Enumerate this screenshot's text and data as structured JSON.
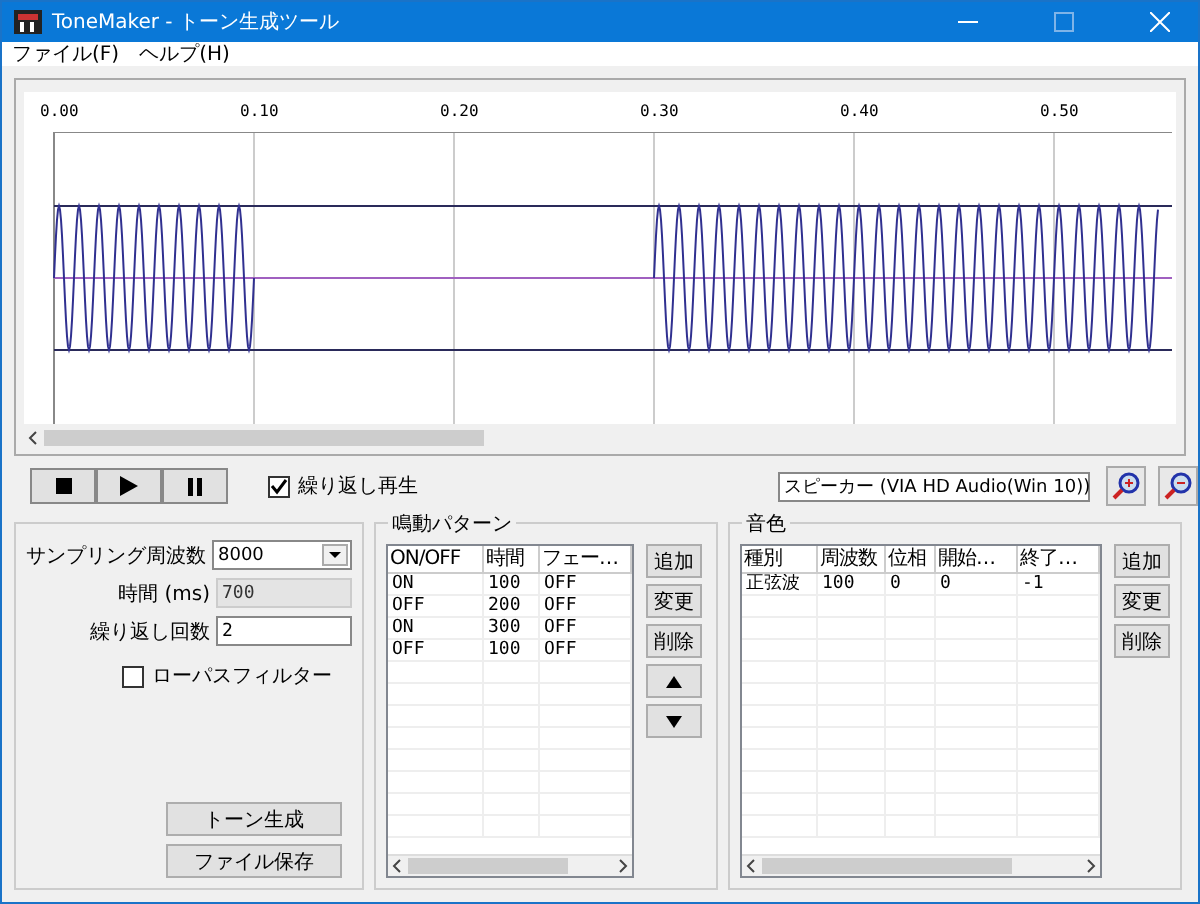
{
  "window": {
    "title": "ToneMaker - トーン生成ツール"
  },
  "menu": [
    "ファイル(F)",
    "ヘルプ(H)"
  ],
  "waveform": {
    "x_labels": [
      "0.00",
      "0.10",
      "0.20",
      "0.30",
      "0.40",
      "0.50"
    ]
  },
  "repeat_play": {
    "label": "繰り返し再生",
    "checked": true
  },
  "device": {
    "value": "スピーカー (VIA HD Audio(Win 10))"
  },
  "settings": {
    "fields": [
      {
        "label": "サンプリング周波数",
        "value": "8000",
        "kind": "select",
        "disabled": false
      },
      {
        "label": "時間 (ms)",
        "value": "700",
        "kind": "text",
        "disabled": true
      },
      {
        "label": "繰り返し回数",
        "value": "2",
        "kind": "text",
        "disabled": false
      }
    ],
    "lowpass": {
      "label": "ローパスフィルター",
      "checked": false
    },
    "buttons": [
      "トーン生成",
      "ファイル保存"
    ]
  },
  "pattern": {
    "title": "鳴動パターン",
    "columns": [
      "ON/OFF",
      "時間",
      "フェー…"
    ],
    "rows": [
      [
        "ON",
        "100",
        "OFF"
      ],
      [
        "OFF",
        "200",
        "OFF"
      ],
      [
        "ON",
        "300",
        "OFF"
      ],
      [
        "OFF",
        "100",
        "OFF"
      ]
    ],
    "buttons": [
      "追加",
      "変更",
      "削除"
    ]
  },
  "tone": {
    "title": "音色",
    "columns": [
      "種別",
      "周波数",
      "位相",
      "開始…",
      "終了…"
    ],
    "rows": [
      [
        "正弦波",
        "100",
        "0",
        "0",
        "-1"
      ]
    ],
    "buttons": [
      "追加",
      "変更",
      "削除"
    ]
  }
}
